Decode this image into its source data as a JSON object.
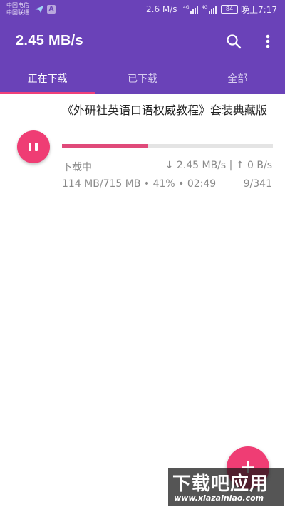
{
  "status_bar": {
    "carrier1": "中国电信",
    "carrier2": "中国联通",
    "badge_a": "A",
    "net_speed": "2.6 M/s",
    "battery": "84",
    "time": "晚上7:17",
    "icons": [
      "airplane-app-icon",
      "signal-4g-icon",
      "battery-icon"
    ]
  },
  "app_bar": {
    "title": "2.45 MB/s",
    "search_icon": "search-icon",
    "menu_icon": "more-vert-icon"
  },
  "tabs": [
    {
      "label": "正在下载",
      "active": true
    },
    {
      "label": "已下载",
      "active": false
    },
    {
      "label": "全部",
      "active": false
    }
  ],
  "download": {
    "title": "《外研社英语口语权威教程》套装典藏版",
    "progress": 0.41,
    "status": "下载中",
    "rate": "↓ 2.45 MB/s | ↑ 0 B/s",
    "detail": "114 MB/715 MB • 41% • 02:49",
    "count": "9/341"
  },
  "fab": {
    "icon": "add-icon",
    "label": "+"
  },
  "watermark": {
    "main": "下载吧应用",
    "url": "www.xiazainiao.com"
  },
  "colors": {
    "primary": "#6a42b8",
    "accent": "#ef3d74"
  }
}
